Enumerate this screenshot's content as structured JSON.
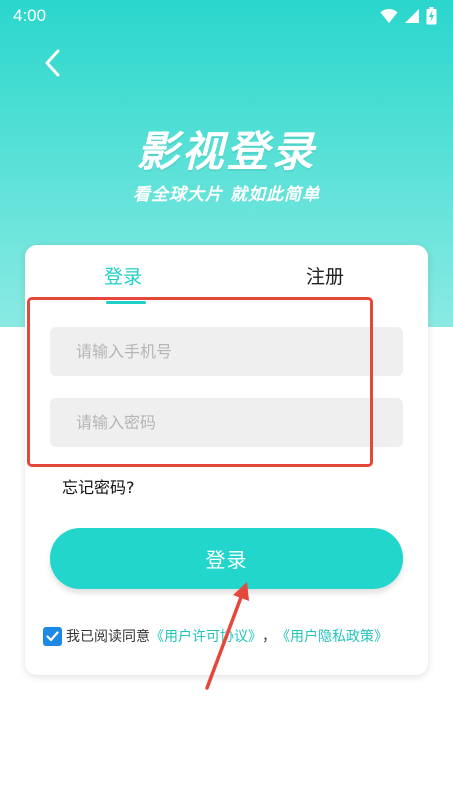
{
  "status_bar": {
    "time": "4:00"
  },
  "hero": {
    "title": "影视登录",
    "subtitle": "看全球大片 就如此简单"
  },
  "tabs": {
    "login": "登录",
    "register": "注册"
  },
  "form": {
    "phone_placeholder": "请输入手机号",
    "password_placeholder": "请输入密码",
    "phone_value": "",
    "password_value": "",
    "forgot_password": "忘记密码?",
    "login_button": "登录"
  },
  "agreement": {
    "checked": true,
    "prefix": "我已阅读同意",
    "user_license": "《用户许可协议》",
    "separator": "，",
    "privacy_policy": "《用户隐私政策》"
  },
  "colors": {
    "accent": "#22d6cc",
    "annotation_red": "#e5483a",
    "checkbox_blue": "#1e88e5"
  }
}
